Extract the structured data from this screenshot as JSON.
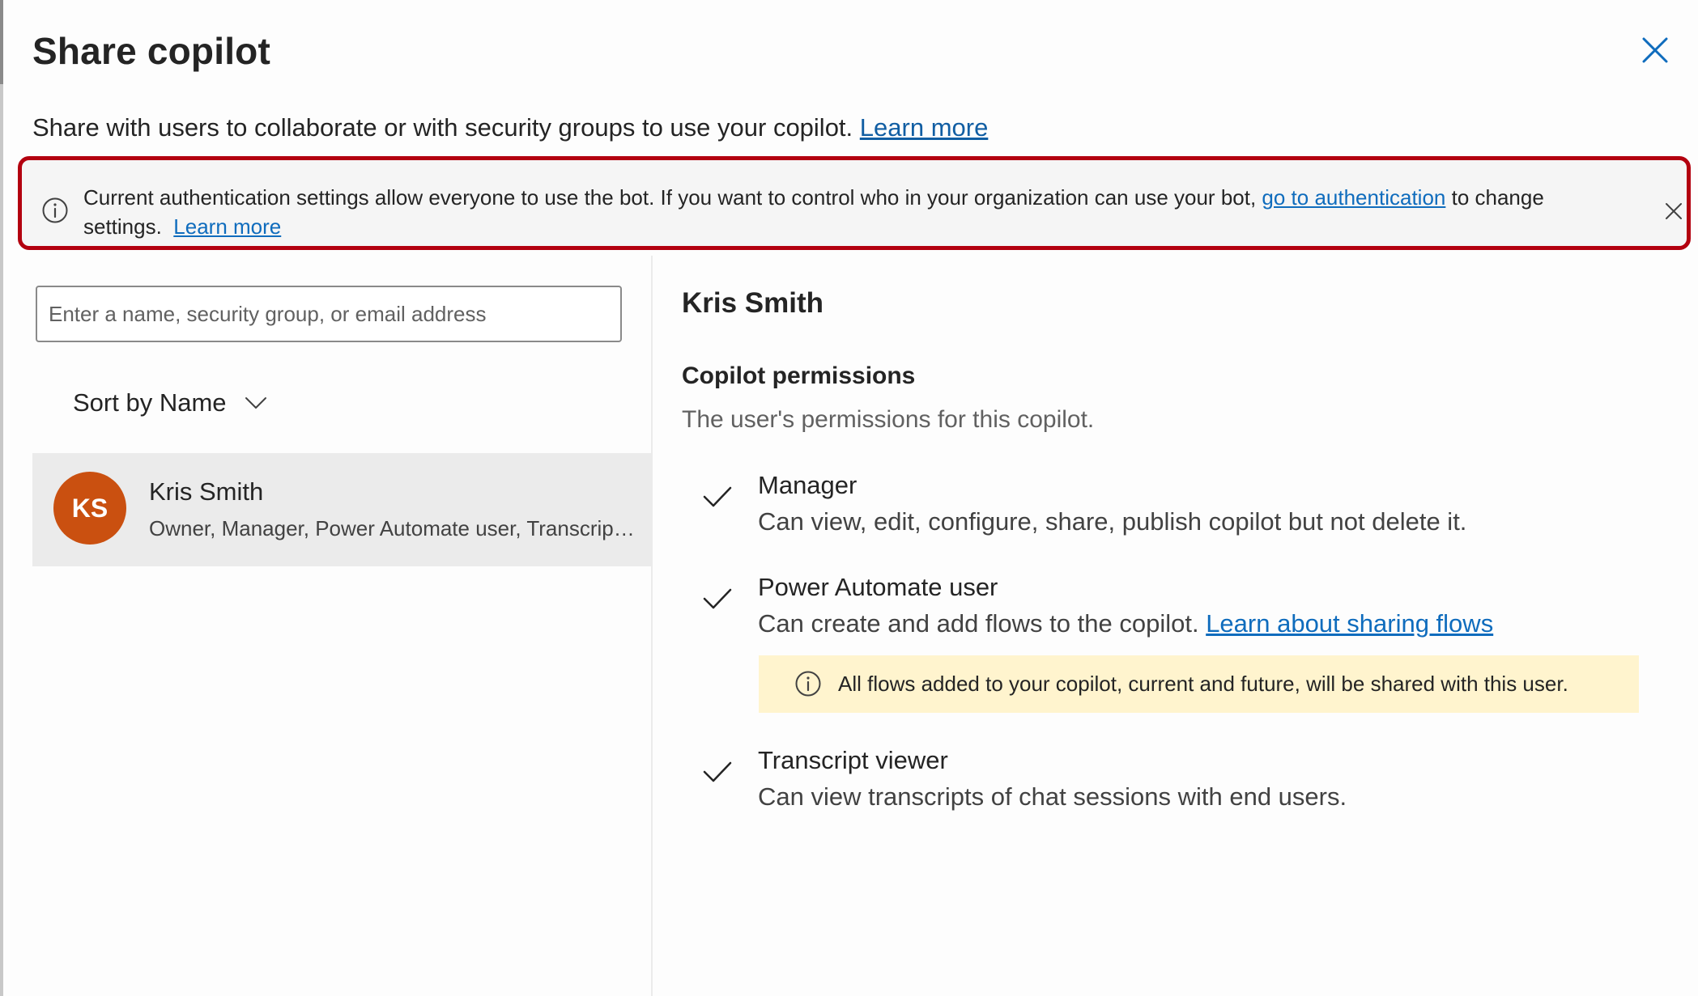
{
  "dialog": {
    "title": "Share copilot",
    "close_label": "Close",
    "subtitle": "Share with users to collaborate or with security groups to use your copilot.",
    "subtitle_link": "Learn more"
  },
  "auth_banner": {
    "text_before": "Current authentication settings allow everyone to use the bot. If you want to control who in your organization can use your bot, ",
    "auth_link": "go to authentication",
    "text_after": " to change settings.",
    "learn_more": "Learn more",
    "icon": "info-icon",
    "dismiss_icon": "close-icon"
  },
  "search": {
    "placeholder": "Enter a name, security group, or email address",
    "value": ""
  },
  "sort": {
    "label": "Sort by Name",
    "icon": "chevron-down-icon"
  },
  "users": [
    {
      "initials": "KS",
      "name": "Kris Smith",
      "roles": "Owner, Manager, Power Automate user, Transcript viewer",
      "avatar_color": "#ca5010"
    }
  ],
  "detail": {
    "name": "Kris Smith",
    "permissions_title": "Copilot permissions",
    "permissions_desc": "The user's permissions for this copilot.",
    "permissions": [
      {
        "name": "Manager",
        "description": "Can view, edit, configure, share, publish copilot but not delete it.",
        "checked": true
      },
      {
        "name": "Power Automate user",
        "description": "Can create and add flows to the copilot.",
        "link": "Learn about sharing flows",
        "checked": true
      },
      {
        "name": "Transcript viewer",
        "description": "Can view transcripts of chat sessions with end users.",
        "checked": true
      }
    ],
    "flows_notice": "All flows added to your copilot, current and future, will be shared with this user."
  },
  "colors": {
    "accent": "#0f6cbd",
    "highlight_border": "#b3000f",
    "avatar": "#ca5010",
    "warning_bg": "#fff4ce"
  }
}
